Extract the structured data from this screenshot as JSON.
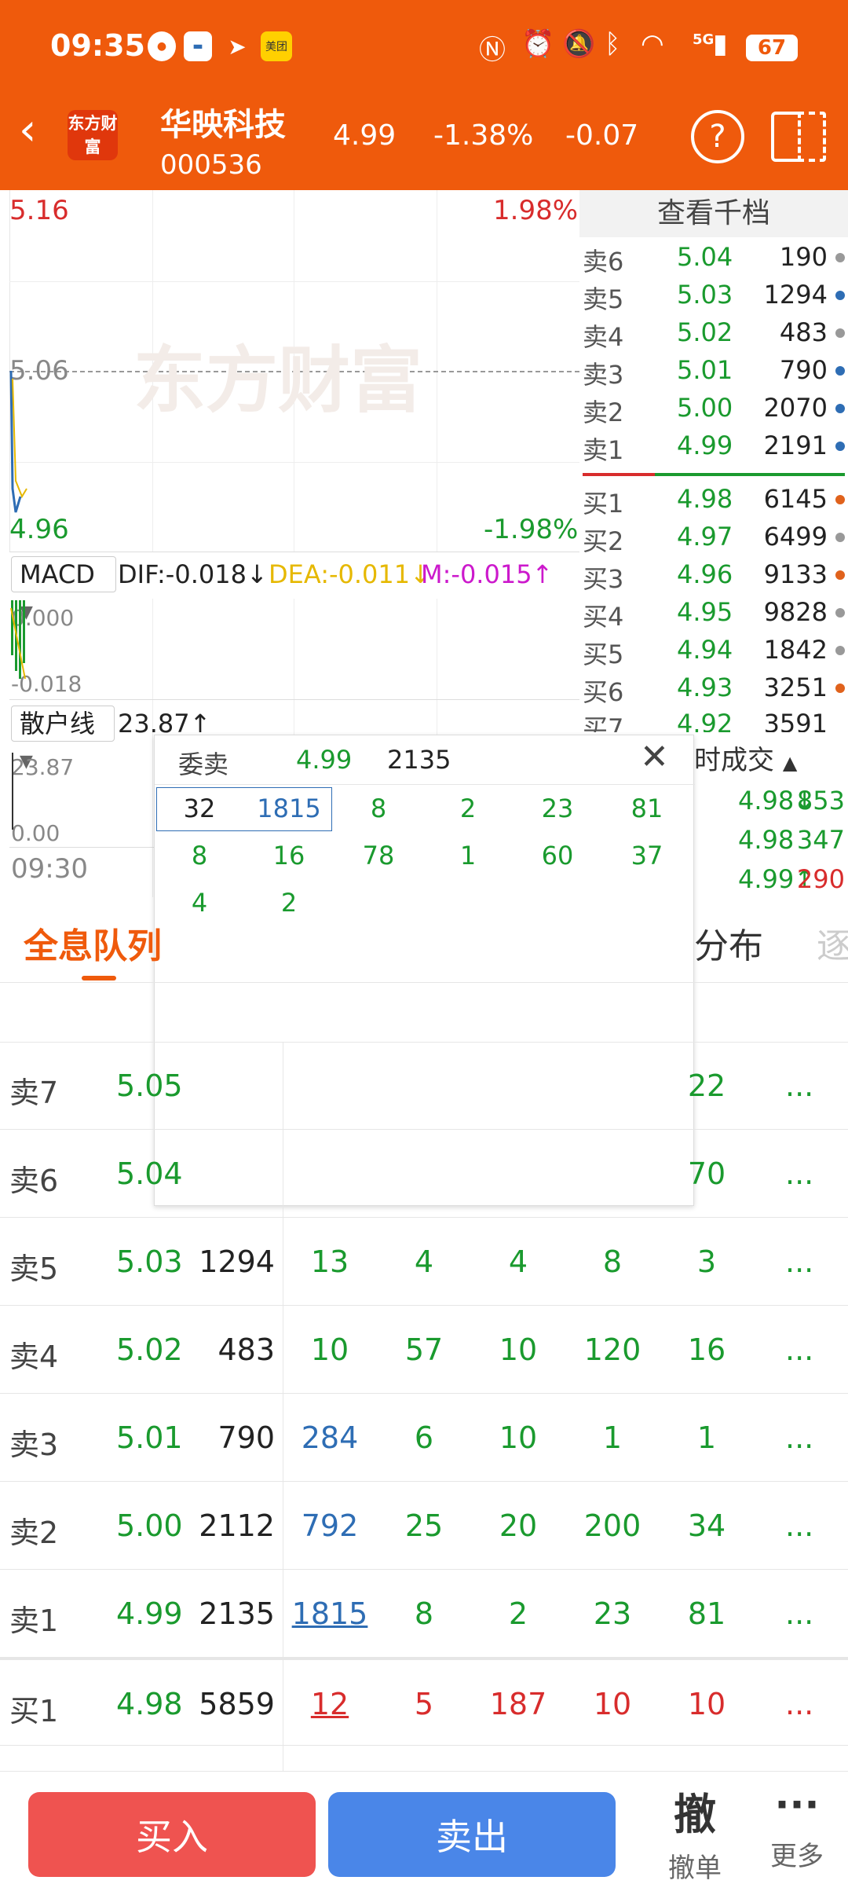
{
  "status_bar": {
    "time": "09:35",
    "battery": "67",
    "network": "5G"
  },
  "header": {
    "logo": "东方财富",
    "stock_name": "华映科技",
    "stock_code": "000536",
    "price": "4.99",
    "change_pct": "-1.38%",
    "change": "-0.07",
    "help": "?"
  },
  "chart": {
    "price_high": "5.16",
    "pct_high": "1.98%",
    "price_mid": "5.06",
    "price_low": "4.96",
    "pct_low": "-1.98%",
    "watermark": "东方财富",
    "macd_label": "MACD",
    "dif": "DIF:-0.018",
    "dea": "DEA:-0.011",
    "m": "M:-0.015",
    "macd_top": "0.000",
    "macd_bottom": "-0.018",
    "retail_label": "散户线",
    "retail_value": "23.87",
    "retail_top": "23.87",
    "retail_bottom": "0.00",
    "time_start": "09:30"
  },
  "book": {
    "header": "查看千档",
    "asks": [
      {
        "k": "卖6",
        "p": "5.04",
        "q": "190",
        "dot": "#999999"
      },
      {
        "k": "卖5",
        "p": "5.03",
        "q": "1294",
        "dot": "#2e6db4"
      },
      {
        "k": "卖4",
        "p": "5.02",
        "q": "483",
        "dot": "#999999"
      },
      {
        "k": "卖3",
        "p": "5.01",
        "q": "790",
        "dot": "#2e6db4"
      },
      {
        "k": "卖2",
        "p": "5.00",
        "q": "2070",
        "dot": "#2e6db4"
      },
      {
        "k": "卖1",
        "p": "4.99",
        "q": "2191",
        "dot": "#2e6db4"
      }
    ],
    "bids": [
      {
        "k": "买1",
        "p": "4.98",
        "q": "6145",
        "dot": "#e0621c"
      },
      {
        "k": "买2",
        "p": "4.97",
        "q": "6499",
        "dot": "#999999"
      },
      {
        "k": "买3",
        "p": "4.96",
        "q": "9133",
        "dot": "#e0621c"
      },
      {
        "k": "买4",
        "p": "4.95",
        "q": "9828",
        "dot": "#999999"
      },
      {
        "k": "买5",
        "p": "4.94",
        "q": "1842",
        "dot": "#999999"
      },
      {
        "k": "买6",
        "p": "4.93",
        "q": "3251",
        "dot": "#e0621c"
      }
    ],
    "partial_row": {
      "k": "买7",
      "p": "4.92",
      "q": "3591"
    }
  },
  "ticks": {
    "header": "时成交",
    "rows": [
      {
        "p": "4.98↓",
        "v": "853",
        "pc": "green",
        "vc": "green"
      },
      {
        "p": "4.98",
        "v": "347",
        "pc": "green",
        "vc": "green"
      },
      {
        "p": "4.99↑",
        "v": "290",
        "pc": "green",
        "vc": "red"
      }
    ]
  },
  "popup": {
    "label": "委卖",
    "price": "4.99",
    "qty": "2135",
    "close": "✕",
    "row1": [
      "32",
      "1815",
      "8",
      "2",
      "23",
      "81"
    ],
    "row2": [
      "8",
      "16",
      "78",
      "1",
      "60",
      "37"
    ],
    "row3": [
      "4",
      "2"
    ]
  },
  "tabs": {
    "active": "全息队列",
    "dist": "分布",
    "more": "逐"
  },
  "table": [
    {
      "k": "卖7",
      "p": "5.05",
      "q": "",
      "vals": [
        "",
        "",
        "",
        "",
        "22"
      ],
      "more": "..."
    },
    {
      "k": "卖6",
      "p": "5.04",
      "q": "",
      "vals": [
        "",
        "",
        "",
        "",
        "70"
      ],
      "more": "..."
    },
    {
      "k": "卖5",
      "p": "5.03",
      "q": "1294",
      "vals": [
        "13",
        "4",
        "4",
        "8",
        "3"
      ],
      "more": "..."
    },
    {
      "k": "卖4",
      "p": "5.02",
      "q": "483",
      "vals": [
        "10",
        "57",
        "10",
        "120",
        "16"
      ],
      "more": "..."
    },
    {
      "k": "卖3",
      "p": "5.01",
      "q": "790",
      "vals": [
        "284",
        "6",
        "10",
        "1",
        "1"
      ],
      "more": "..."
    },
    {
      "k": "卖2",
      "p": "5.00",
      "q": "2112",
      "vals": [
        "792",
        "25",
        "20",
        "200",
        "34"
      ],
      "more": "..."
    },
    {
      "k": "卖1",
      "p": "4.99",
      "q": "2135",
      "vals": [
        "1815",
        "8",
        "2",
        "23",
        "81"
      ],
      "more": "..."
    },
    {
      "k": "买1",
      "p": "4.98",
      "q": "5859",
      "vals": [
        "12",
        "5",
        "187",
        "10",
        "10"
      ],
      "more": "..."
    }
  ],
  "bottom": {
    "buy": "买入",
    "sell": "卖出",
    "cancel_icon_text": "撤",
    "cancel_label": "撤单",
    "more_icon_text": "···",
    "more_label": "更多"
  },
  "colors": {
    "brand": "#ef5a0c",
    "buy": "#ef5350",
    "sell": "#4a86e8",
    "up": "#d82c2c",
    "down": "#1a9a2e"
  }
}
